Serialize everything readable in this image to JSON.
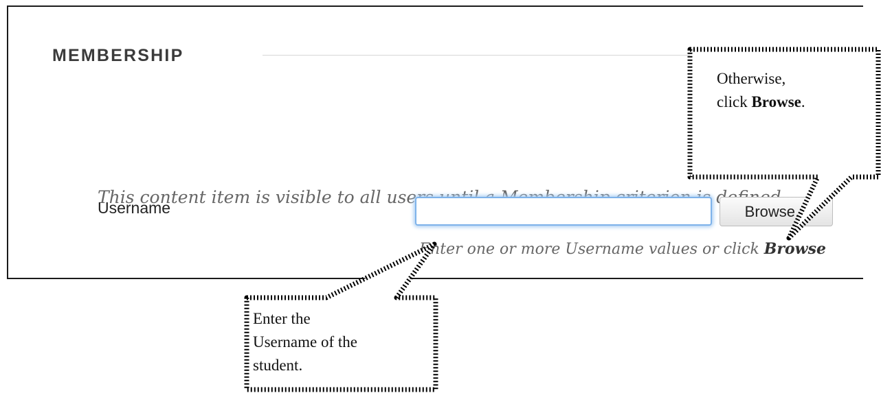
{
  "membership": {
    "title": "MEMBERSHIP",
    "notice": "This content item is visible to all users until a Membership criterion is defined",
    "username_label": "Username",
    "username_value": "",
    "browse_label": "Browse...",
    "help_text": "Enter one or more Username values or click ",
    "help_text_bold": "Browse"
  },
  "callouts": {
    "browse": {
      "line1": "Otherwise,",
      "line2_prefix": "click ",
      "line2_bold": "Browse",
      "line2_suffix": "."
    },
    "username": {
      "line1": "Enter the",
      "line2": "Username of the",
      "line3": "student."
    }
  }
}
